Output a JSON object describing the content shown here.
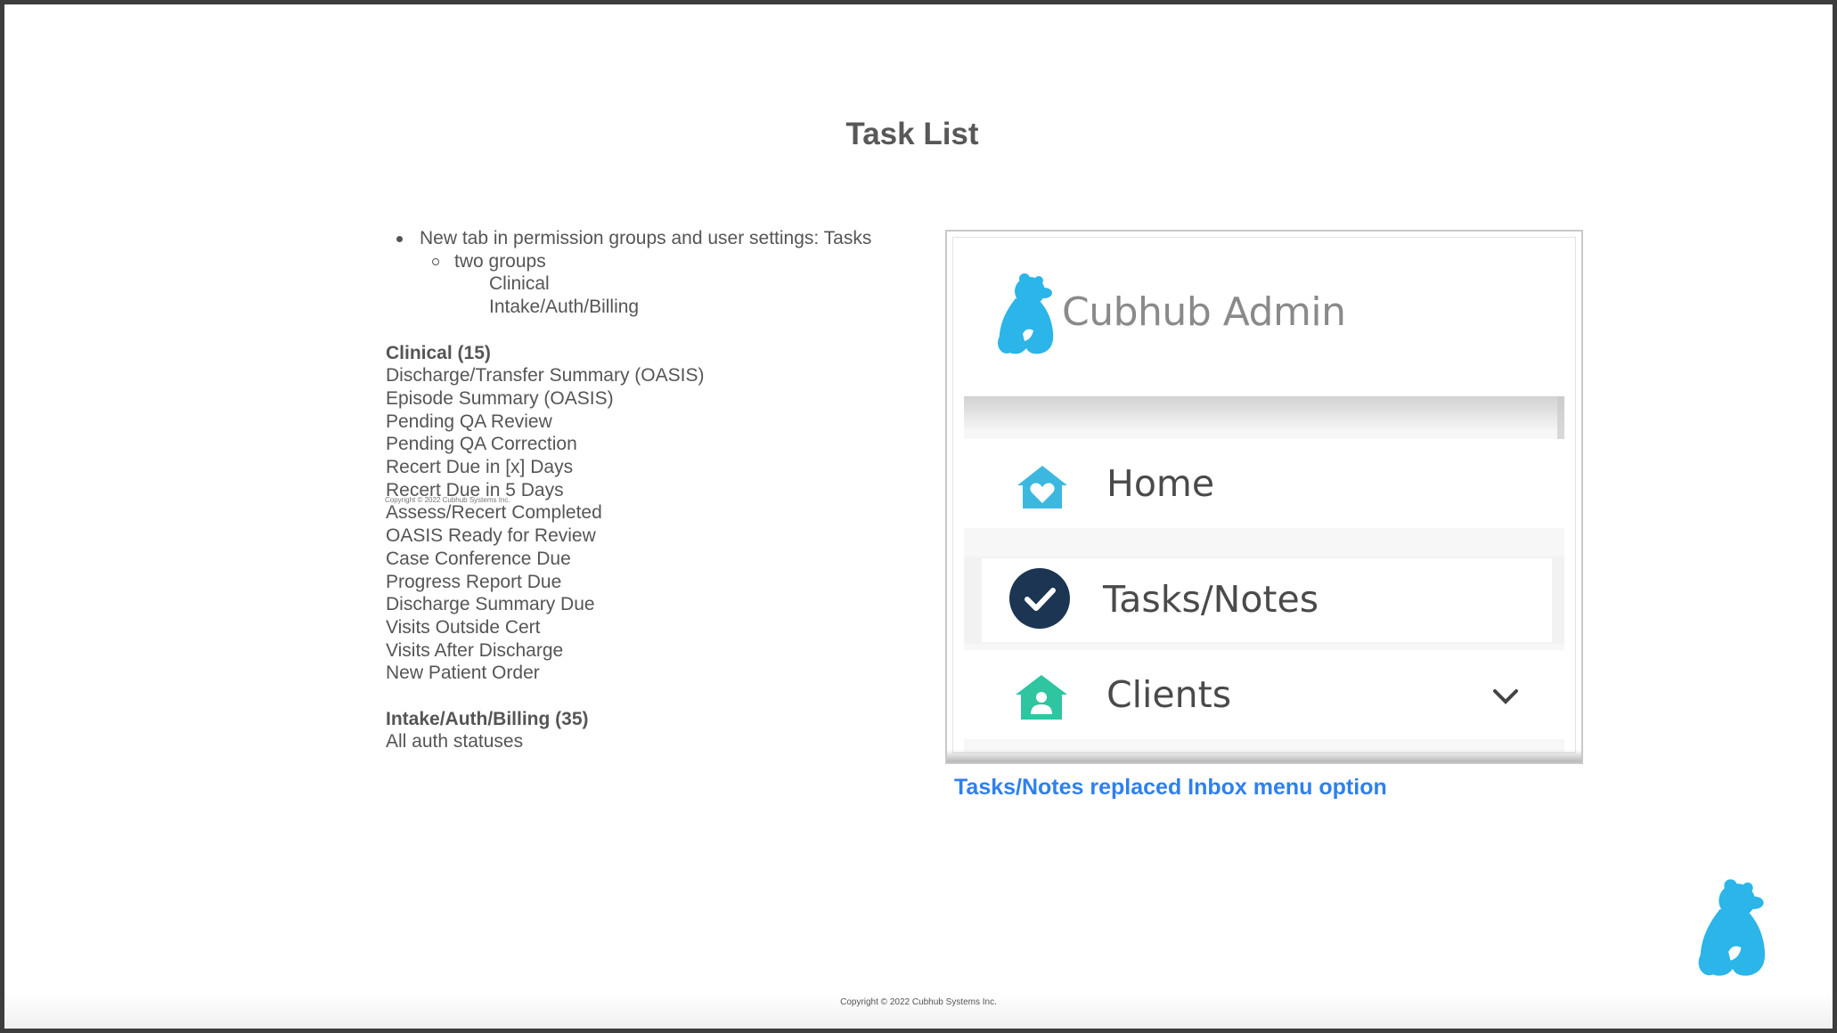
{
  "slide": {
    "title": "Task List",
    "bullet": "New tab in permission groups and user settings: Tasks",
    "sub_bullet": "two groups",
    "groups": [
      "Clinical",
      "Intake/Auth/Billing"
    ],
    "clinical_heading": "Clinical (15)",
    "clinical_items": [
      "Discharge/Transfer Summary (OASIS)",
      "Episode Summary (OASIS)",
      "Pending QA Review",
      "Pending QA Correction",
      "Recert Due in [x] Days",
      "Recert Due in 5 Days",
      "Assess/Recert Completed",
      "OASIS Ready for Review",
      "Case Conference Due",
      "Progress Report Due",
      "Discharge Summary Due",
      "Visits Outside Cert",
      "Visits After Discharge",
      "New Patient Order"
    ],
    "intake_heading": "Intake/Auth/Billing (35)",
    "intake_items": [
      "All auth statuses"
    ],
    "inline_copyright": "Copyright © 2022 Cubhub Systems Inc.",
    "caption": "Tasks/Notes replaced Inbox menu option",
    "footer": "Copyright © 2022 Cubhub Systems Inc."
  },
  "screenshot": {
    "app_title": "Cubhub Admin",
    "menu": [
      {
        "label": "Home",
        "icon": "home-heart-icon",
        "color": "#3cb8e0"
      },
      {
        "label": "Tasks/Notes",
        "icon": "check-circle-icon",
        "color": "#1c3552"
      },
      {
        "label": "Clients",
        "icon": "home-person-icon",
        "color": "#2ec5a0"
      }
    ]
  },
  "colors": {
    "logo_blue": "#2bb5e8",
    "caption_blue": "#2f80ed",
    "text_gray": "#555555"
  }
}
